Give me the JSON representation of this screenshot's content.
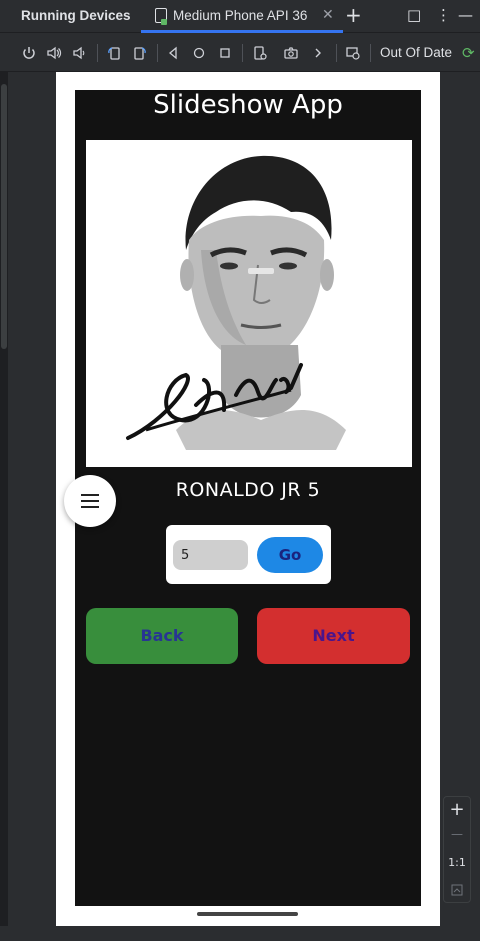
{
  "titlebar": {
    "panel_title": "Running Devices",
    "tab_label": "Medium Phone API 36",
    "tab_close": "✕",
    "add_tab": "+",
    "maximize": "□",
    "more": "⋮",
    "minimize": "—"
  },
  "toolbar": {
    "status_label": "Out Of Date"
  },
  "app": {
    "title": "Slideshow App",
    "caption": "RONALDO JR 5",
    "number_input_value": "5",
    "go_label": "Go",
    "back_label": "Back",
    "next_label": "Next"
  },
  "zoom": {
    "zoom_in": "+",
    "zoom_out": "—",
    "actual_size": "1:1"
  },
  "colors": {
    "accent_tab": "#3574f0",
    "go_button": "#1e88e5",
    "back_button": "#388e3c",
    "next_button": "#d32f2f",
    "sync_icon": "#5fb865"
  },
  "icons": [
    "power-icon",
    "volume-up-icon",
    "volume-down-icon",
    "rotate-left-icon",
    "rotate-right-icon",
    "back-icon",
    "home-icon",
    "overview-icon",
    "device-settings-icon",
    "camera-icon",
    "chevron-right-icon",
    "screen-record-icon",
    "sync-icon",
    "hamburger-menu-icon"
  ]
}
